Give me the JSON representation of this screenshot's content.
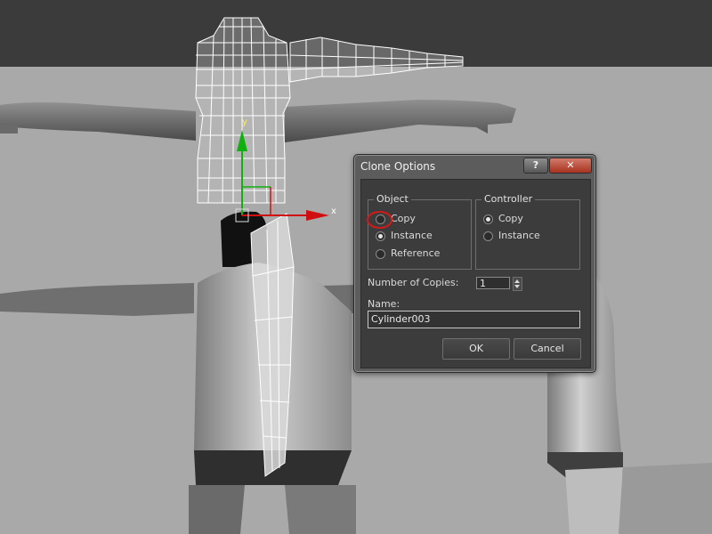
{
  "viewport": {
    "axis_x_label": "x",
    "axis_y_label": "y"
  },
  "dialog": {
    "title": "Clone Options",
    "help_label": "?",
    "close_label": "✕",
    "object_group": {
      "title": "Object",
      "options": [
        "Copy",
        "Instance",
        "Reference"
      ],
      "selected": "Instance"
    },
    "controller_group": {
      "title": "Controller",
      "options": [
        "Copy",
        "Instance"
      ],
      "selected": "Copy"
    },
    "copies_label": "Number of Copies:",
    "copies_value": "1",
    "name_label": "Name:",
    "name_value": "Cylinder003",
    "ok_label": "OK",
    "cancel_label": "Cancel"
  },
  "colors": {
    "highlight": "#d11a1a",
    "gizmo_x": "#d01010",
    "gizmo_y": "#10b010"
  }
}
